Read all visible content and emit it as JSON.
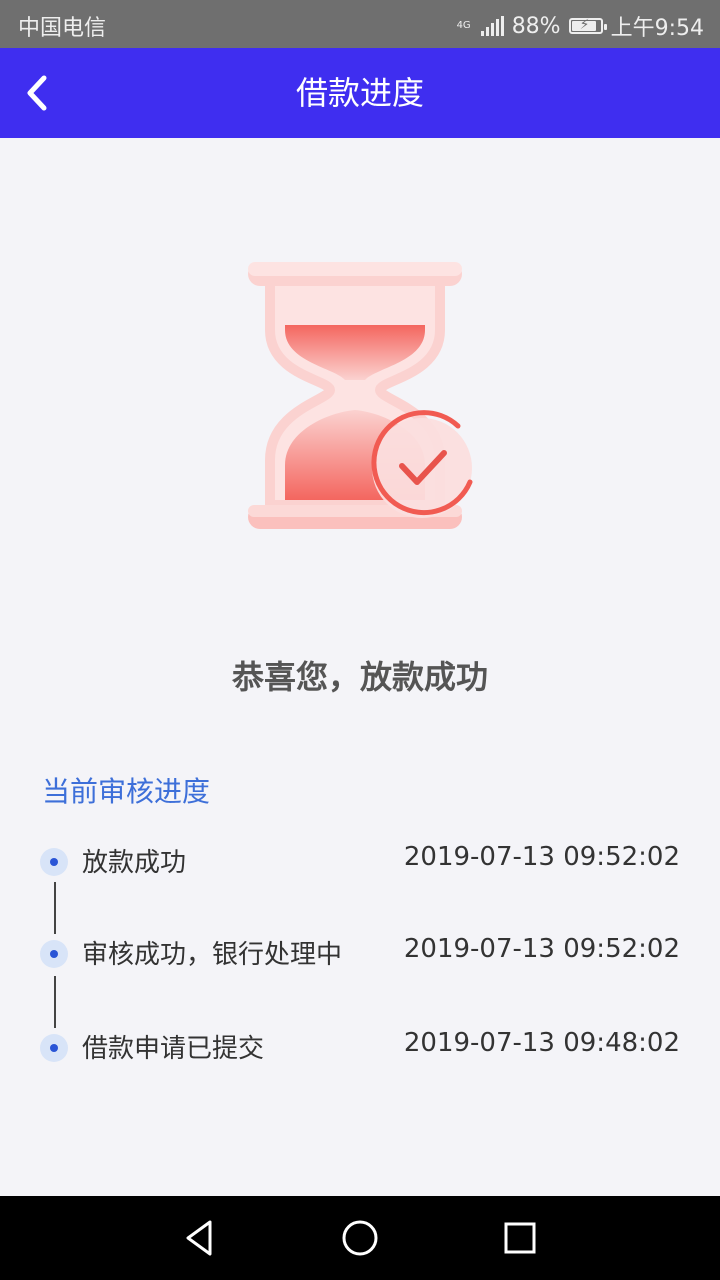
{
  "status_bar": {
    "carrier": "中国电信",
    "network": "4G",
    "battery_percent": "88%",
    "battery_level": 0.88,
    "time": "上午9:54"
  },
  "header": {
    "title": "借款进度",
    "back_icon": "chevron-left-icon"
  },
  "illustration": {
    "icon": "hourglass-check-icon",
    "colors": {
      "primary": "#f4665f",
      "light": "#fbd2d0"
    }
  },
  "result": {
    "message": "恭喜您，放款成功"
  },
  "progress": {
    "title": "当前审核进度",
    "steps": [
      {
        "label": "放款成功",
        "time": "2019-07-13 09:52:02"
      },
      {
        "label": "审核成功，银行处理中",
        "time": "2019-07-13 09:52:02"
      },
      {
        "label": "借款申请已提交",
        "time": "2019-07-13 09:48:02"
      }
    ]
  },
  "nav_bar": {
    "back": "triangle-back-icon",
    "home": "circle-home-icon",
    "recents": "square-recents-icon"
  },
  "colors": {
    "header": "#3f2ef0",
    "section_title": "#3d6fd9",
    "timeline_dot": "#2a55d6"
  }
}
